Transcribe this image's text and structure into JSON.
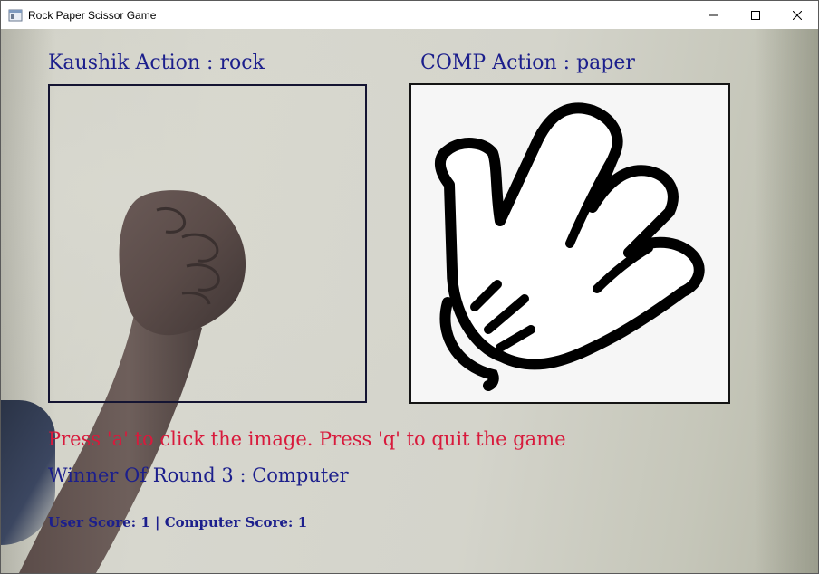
{
  "window": {
    "title": "Rock Paper Scissor Game",
    "controls": [
      "minimize",
      "maximize",
      "close"
    ]
  },
  "game": {
    "user_action_label": "Kaushik Action : rock",
    "comp_action_label": "COMP Action : paper",
    "instruction": "Press 'a' to click the image. Press 'q' to quit the game",
    "winner_text": "Winner Of Round 3 : Computer",
    "score_text": "User Score: 1 | Computer Score: 1",
    "user_action": "rock",
    "comp_action": "paper"
  },
  "colors": {
    "label_blue": "#1c1f8c",
    "hint_red": "#d81a3c"
  },
  "icons": {
    "app": "app-window-icon",
    "computer_hand": "paper-hand-icon"
  }
}
